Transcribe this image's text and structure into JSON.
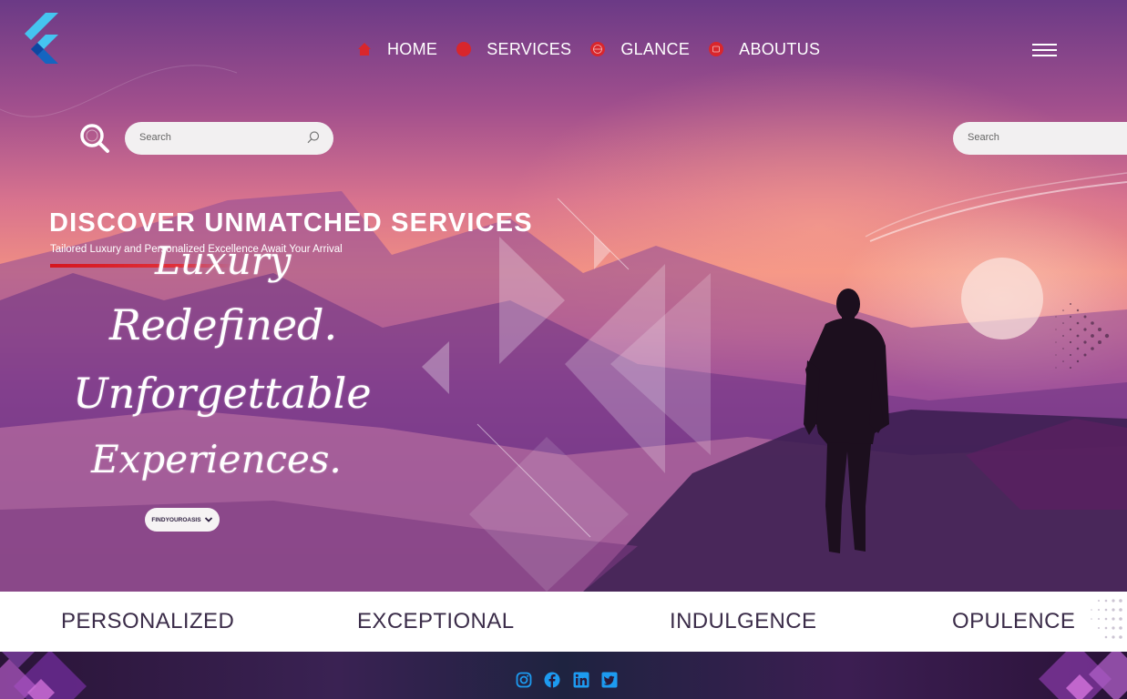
{
  "nav": {
    "items": [
      {
        "label": "HOME",
        "icon": "home-icon"
      },
      {
        "label": "SERVICES",
        "icon": "services-icon"
      },
      {
        "label": "GLANCE",
        "icon": "globe-icon"
      },
      {
        "label": "ABOUTUS",
        "icon": "about-icon"
      }
    ],
    "menu_icon": "hamburger-menu-icon"
  },
  "search": {
    "placeholder": "Search",
    "secondary_placeholder": "Search"
  },
  "hero": {
    "headline": "DISCOVER UNMATCHED  SERVICES",
    "subline": "Tailored Luxury and Personalized Excellence Await Your Arrival",
    "script_lines": [
      "Luxury",
      "Redefined.",
      "Unforgettable",
      "Experiences."
    ],
    "cta_label": "FINDYOUROASIS"
  },
  "band": {
    "words": [
      "PERSONALIZED",
      "EXCEPTIONAL",
      "INDULGENCE",
      "OPULENCE"
    ]
  },
  "footer": {
    "social_icons": [
      "instagram-icon",
      "facebook-icon",
      "linkedin-icon",
      "twitter-icon"
    ]
  },
  "colors": {
    "accent_red": "#d9262c",
    "social_blue": "#1d9bf0",
    "band_text": "#3b2c49"
  }
}
